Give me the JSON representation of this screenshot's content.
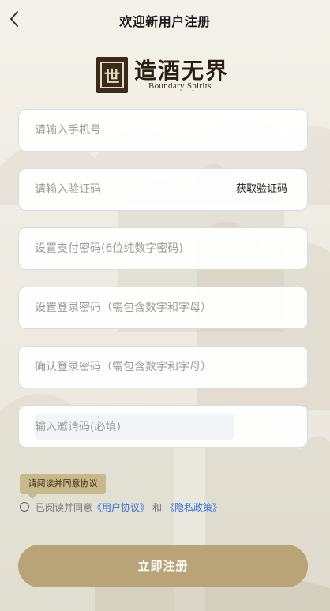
{
  "header": {
    "title": "欢迎新用户注册",
    "back_icon": "chevron-left-icon"
  },
  "logo": {
    "seal_char": "世",
    "name_cn": "造酒无界",
    "name_en": "Boundary Spirits"
  },
  "form": {
    "phone_placeholder": "请输入手机号",
    "code_placeholder": "请输入验证码",
    "get_code_label": "获取验证码",
    "pay_password_placeholder": "设置支付密码(6位纯数字密码)",
    "login_password_placeholder": "设置登录密码（需包含数字和字母）",
    "confirm_password_placeholder": "确认登录密码（需包含数字和字母）",
    "invite_placeholder": "输入邀请码(必填)"
  },
  "agreement": {
    "tooltip": "请阅读并同意协议",
    "prefix": "已阅读并同意",
    "user_agreement": "《用户协议》",
    "and": "和",
    "privacy_policy": "《隐私政策》",
    "checked": false
  },
  "submit_label": "立即注册",
  "colors": {
    "accent": "#b8a476",
    "tooltip_bg": "#c8b98a",
    "link": "#2f6fd6",
    "background": "#f4f1ea"
  }
}
